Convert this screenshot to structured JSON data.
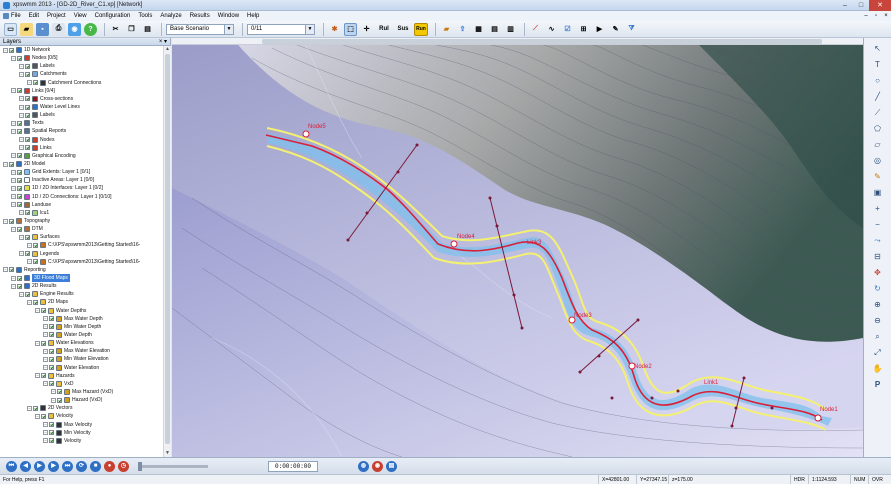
{
  "window": {
    "title": "xpswmm 2013 - [GD-2D_River_C1.xp] [Network]"
  },
  "menu": [
    "File",
    "Edit",
    "Project",
    "View",
    "Configuration",
    "Tools",
    "Analyze",
    "Results",
    "Window",
    "Help"
  ],
  "toolbar": {
    "scenario": "Base Scenario",
    "run_selector": "0/11",
    "buttons": [
      "Rul",
      "Sus",
      "Run"
    ]
  },
  "layers_panel": {
    "title": "Layers",
    "items": [
      {
        "label": "1D Network",
        "level": 0,
        "icon": "network-icon",
        "color": "#2f6fc4"
      },
      {
        "label": "Nodes [0/5]",
        "level": 1,
        "icon": "node-icon",
        "color": "#c8402f"
      },
      {
        "label": "Labels",
        "level": 2,
        "icon": "label-icon",
        "color": "#555555"
      },
      {
        "label": "Catchments",
        "level": 2,
        "icon": "catchment-icon",
        "color": "#7aa7d8"
      },
      {
        "label": "Catchment Connections",
        "level": 3,
        "icon": "connection-icon",
        "color": "#333333"
      },
      {
        "label": "Links [0/4]",
        "level": 1,
        "icon": "link-icon",
        "color": "#c8402f"
      },
      {
        "label": "Cross-sections",
        "level": 2,
        "icon": "crosssection-icon",
        "color": "#8a1a1a"
      },
      {
        "label": "Water Level Lines",
        "level": 2,
        "icon": "waterline-icon",
        "color": "#2f6fc4"
      },
      {
        "label": "Labels",
        "level": 2,
        "icon": "label-icon",
        "color": "#555555"
      },
      {
        "label": "Texts",
        "level": 1,
        "icon": "text-icon",
        "color": "#5c6f89"
      },
      {
        "label": "Spatial Reports",
        "level": 1,
        "icon": "report-icon",
        "color": "#5c6f89"
      },
      {
        "label": "Nodes",
        "level": 2,
        "icon": "node-icon",
        "color": "#c8402f"
      },
      {
        "label": "Links",
        "level": 2,
        "icon": "link-icon",
        "color": "#c8402f"
      },
      {
        "label": "Graphical Encoding",
        "level": 1,
        "icon": "encoding-icon",
        "color": "#5aa040"
      },
      {
        "label": "2D Model",
        "level": 0,
        "icon": "model-icon",
        "color": "#2f6fc4"
      },
      {
        "label": "Grid Extents: Layer 1 [0/1]",
        "level": 1,
        "icon": "grid-icon",
        "color": "#80c0f0"
      },
      {
        "label": "Inactive Areas: Layer 1 [0/0]",
        "level": 1,
        "icon": "inactive-icon",
        "color": "#ffffff"
      },
      {
        "label": "1D / 2D Interfaces: Layer 1 [0/2]",
        "level": 1,
        "icon": "interface-icon",
        "color": "#e0e040"
      },
      {
        "label": "1D / 2D Connections: Layer 1 [0/10]",
        "level": 1,
        "icon": "connection-icon",
        "color": "#d040d0"
      },
      {
        "label": "Landuse",
        "level": 1,
        "icon": "landuse-icon",
        "color": "#9a6a3a"
      },
      {
        "label": "lcu1",
        "level": 2,
        "icon": "polygon-icon",
        "color": "#a0d080"
      },
      {
        "label": "Topography",
        "level": 0,
        "icon": "topography-icon",
        "color": "#b0703a"
      },
      {
        "label": "DTM",
        "level": 1,
        "icon": "dtm-icon",
        "color": "#b0703a"
      },
      {
        "label": "Surfaces",
        "level": 2,
        "icon": "folder-icon",
        "color": "#e8c040"
      },
      {
        "label": "C:\\XPS\\xpswmm2013\\Getting Started\\16-",
        "level": 3,
        "icon": "surface-icon",
        "color": "#c87020"
      },
      {
        "label": "Legends",
        "level": 2,
        "icon": "folder-icon",
        "color": "#e8c040"
      },
      {
        "label": "C:\\XPS\\xpswmm2013\\Getting Started\\16-",
        "level": 3,
        "icon": "legend-icon",
        "color": "#c87020"
      },
      {
        "label": "Reporting",
        "level": 0,
        "icon": "reporting-icon",
        "color": "#2f6fc4"
      },
      {
        "label": "3D Flood Maps",
        "level": 1,
        "icon": "flood-icon",
        "color": "#2f6fc4",
        "selected": true
      },
      {
        "label": "2D Results",
        "level": 1,
        "icon": "results-icon",
        "color": "#2f6fc4"
      },
      {
        "label": "Engine Results",
        "level": 2,
        "icon": "folder-icon",
        "color": "#e8c040"
      },
      {
        "label": "2D Maps",
        "level": 3,
        "icon": "folder-icon",
        "color": "#e8c040"
      },
      {
        "label": "Water Depths",
        "level": 4,
        "icon": "folder-icon",
        "color": "#e8c040"
      },
      {
        "label": "Max Water Depth",
        "level": 5,
        "icon": "map-icon",
        "color": "#d0a020"
      },
      {
        "label": "Min Water Depth",
        "level": 5,
        "icon": "map-icon",
        "color": "#d0a020"
      },
      {
        "label": "Water Depth",
        "level": 5,
        "icon": "map-icon",
        "color": "#d0a020"
      },
      {
        "label": "Water Elevations",
        "level": 4,
        "icon": "folder-icon",
        "color": "#e8c040"
      },
      {
        "label": "Max Water Elevation",
        "level": 5,
        "icon": "map-icon",
        "color": "#d0a020"
      },
      {
        "label": "Min Water Elevation",
        "level": 5,
        "icon": "map-icon",
        "color": "#d0a020"
      },
      {
        "label": "Water Elevation",
        "level": 5,
        "icon": "map-icon",
        "color": "#d0a020"
      },
      {
        "label": "Hazards",
        "level": 4,
        "icon": "folder-icon",
        "color": "#e8c040"
      },
      {
        "label": "VxD",
        "level": 5,
        "icon": "folder-icon",
        "color": "#e8c040"
      },
      {
        "label": "Max Hazard (VxD)",
        "level": 6,
        "icon": "map-icon",
        "color": "#d0a020"
      },
      {
        "label": "Hazard (VxD)",
        "level": 6,
        "icon": "map-icon",
        "color": "#d0a020"
      },
      {
        "label": "2D Vectors",
        "level": 3,
        "icon": "vector-icon",
        "color": "#333333"
      },
      {
        "label": "Velocity",
        "level": 4,
        "icon": "folder-icon",
        "color": "#e8c040"
      },
      {
        "label": "Max Velocity",
        "level": 5,
        "icon": "vector-icon",
        "color": "#333333"
      },
      {
        "label": "Min Velocity",
        "level": 5,
        "icon": "vector-icon",
        "color": "#333333"
      },
      {
        "label": "Velocity",
        "level": 5,
        "icon": "vector-icon",
        "color": "#333333"
      }
    ]
  },
  "map": {
    "nodes": [
      {
        "label": "Node5"
      },
      {
        "label": "Node4"
      },
      {
        "label": "Link3"
      },
      {
        "label": "Node3"
      },
      {
        "label": "Node2"
      },
      {
        "label": "Link1"
      },
      {
        "label": "Node1"
      }
    ]
  },
  "playback": {
    "time": "0:00:00:00"
  },
  "statusbar": {
    "help": "For Help, press F1",
    "x": "X=42801.00",
    "y": "Y=27347.15",
    "z": "z=175.00",
    "hdr": "HDR",
    "scale": "1:1124.593",
    "num": "NUM",
    "ovr": "OVR"
  },
  "colors": {
    "accent": "#2f6fc4",
    "river_line": "#d8203a",
    "bank_line": "#f4f070",
    "cross_section": "#7a1a3a"
  }
}
